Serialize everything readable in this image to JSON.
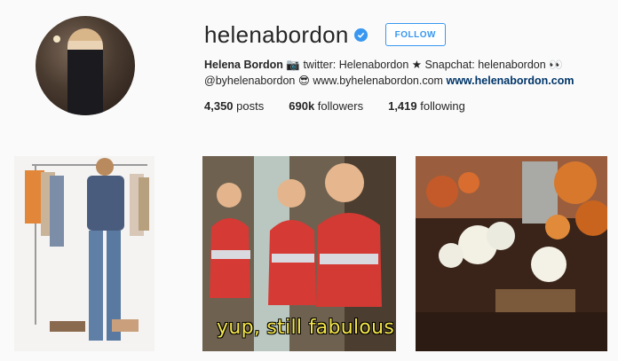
{
  "profile": {
    "username": "helenabordon",
    "follow_label": "FOLLOW",
    "bio": {
      "name": "Helena Bordon",
      "segment1": "twitter: Helenabordon",
      "segment2": "Snapchat: helenabordon",
      "segment3": "@byhelenabordon",
      "segment4": "www.byhelenabordon.com",
      "link": "www.helenabordon.com"
    },
    "stats": {
      "posts_count": "4,350",
      "posts_label": "posts",
      "followers_count": "690k",
      "followers_label": "followers",
      "following_count": "1,419",
      "following_label": "following"
    }
  },
  "posts": [
    {
      "icon": "fashion-photo"
    },
    {
      "caption": "yup, still fabulous"
    },
    {
      "icon": "flowers-photo"
    }
  ],
  "colors": {
    "accent": "#3897f0",
    "link": "#003569",
    "caption": "#f3e54a",
    "background": "#fafafa"
  }
}
